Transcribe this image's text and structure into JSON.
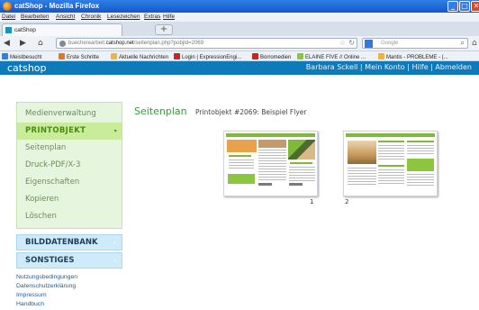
{
  "window": {
    "title": "catShop - Mozilla Firefox",
    "controls": {
      "minimize": "_",
      "maximize": "□",
      "close": "✕"
    }
  },
  "menu": [
    "Datei",
    "Bearbeiten",
    "Ansicht",
    "Chronik",
    "Lesezeichen",
    "Extras",
    "Hilfe"
  ],
  "tab": {
    "label": "catShop",
    "new_tab": "+"
  },
  "nav": {
    "url_prefix": "buecherearbeit.",
    "url_domain": "catshop.net",
    "url_path": "/seitenplan.php?pobjId=2069",
    "search_placeholder": "Google"
  },
  "bookmarks": [
    {
      "label": "Meistbesucht",
      "color": "#2f7fe6"
    },
    {
      "label": "Erste Schritte",
      "color": "#e8761b"
    },
    {
      "label": "Aktuelle Nachrichten",
      "color": "#f2b33d"
    },
    {
      "label": "Login | ExpressionEngi...",
      "color": "#c8271f"
    },
    {
      "label": "Borromedien",
      "color": "#c8271f"
    },
    {
      "label": "ELAINE FIVE // Online ...",
      "color": "#8cc63f"
    },
    {
      "label": "Mantis - PROBLEME - (...",
      "color": "#f2b33d"
    }
  ],
  "site": {
    "logo": "catshop",
    "user_links": "Barbara Sckell | Mein Konto | Hilfe | Abmelden"
  },
  "sidebar": {
    "green_items": [
      {
        "label": "Medienverwaltung",
        "active": false
      },
      {
        "label": "PRINTOBJEKT",
        "active": true,
        "caret": "▾"
      },
      {
        "label": "Seitenplan",
        "active": false
      },
      {
        "label": "Druck-PDF/X-3",
        "active": false
      },
      {
        "label": "Eigenschaften",
        "active": false
      },
      {
        "label": "Kopieren",
        "active": false
      },
      {
        "label": "Löschen",
        "active": false
      }
    ],
    "blue_items": [
      {
        "label": "BILDDATENBANK",
        "arrow": "›"
      },
      {
        "label": "SONSTIGES",
        "arrow": "›"
      }
    ],
    "footer_links": [
      "Nutzungsbedingungen",
      "Datenschutzerklärung",
      "Impressum",
      "Handbuch"
    ]
  },
  "main": {
    "heading": "Seitenplan",
    "subheading": "Printobjekt #2069: Beispiel Flyer",
    "pages": [
      {
        "number": "1"
      },
      {
        "number": "2"
      }
    ]
  },
  "colors": {
    "titlebar": "#1f66d6",
    "site_header": "#0f7ab9",
    "green_nav_bg": "#e6f5dd",
    "green_active": "#c8ec9a",
    "blue_nav_bg": "#cfeaf9",
    "heading_green": "#2f9f2f"
  }
}
